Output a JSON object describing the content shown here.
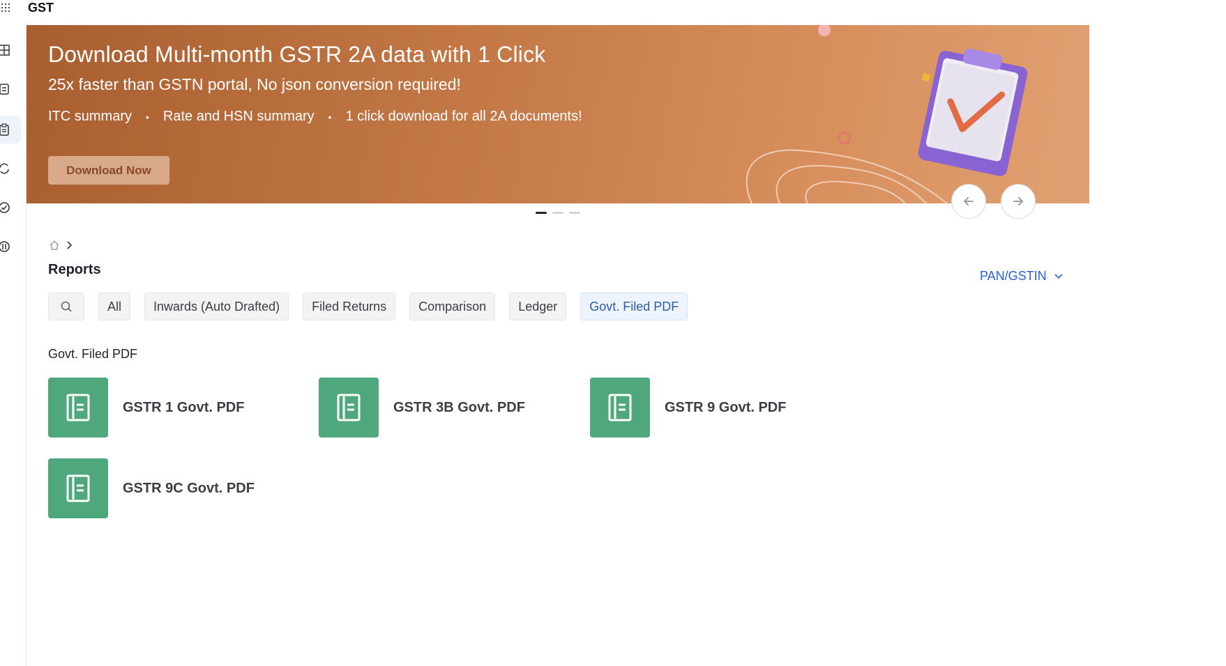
{
  "app": {
    "title": "GST"
  },
  "banner": {
    "title": "Download Multi-month GSTR 2A data with 1 Click",
    "subtitle": "25x faster than GSTN portal, No json conversion required!",
    "features": [
      "ITC summary",
      "Rate and HSN summary",
      "1 click download for all 2A documents!"
    ],
    "feature_separator": "•",
    "cta_label": "Download Now",
    "slides_total": 3,
    "slide_active": 1
  },
  "nav": {
    "prev_icon": "arrow-left-icon",
    "next_icon": "arrow-right-icon"
  },
  "page": {
    "title": "Reports"
  },
  "pan_select": {
    "label": "PAN/GSTIN"
  },
  "filters": {
    "items": [
      "All",
      "Inwards (Auto Drafted)",
      "Filed Returns",
      "Comparison",
      "Ledger",
      "Govt. Filed PDF"
    ],
    "active": "Govt. Filed PDF"
  },
  "section": {
    "title": "Govt. Filed PDF"
  },
  "reports": [
    {
      "label": "GSTR 1 Govt. PDF",
      "icon": "document-icon"
    },
    {
      "label": "GSTR 3B Govt. PDF",
      "icon": "document-icon"
    },
    {
      "label": "GSTR 9 Govt. PDF",
      "icon": "document-icon"
    },
    {
      "label": "GSTR 9C Govt. PDF",
      "icon": "document-icon"
    }
  ],
  "colors": {
    "accent_blue": "#2a5fd6",
    "report_green": "#4fa77d",
    "banner_start": "#a95e30",
    "banner_end": "#e0a172"
  }
}
